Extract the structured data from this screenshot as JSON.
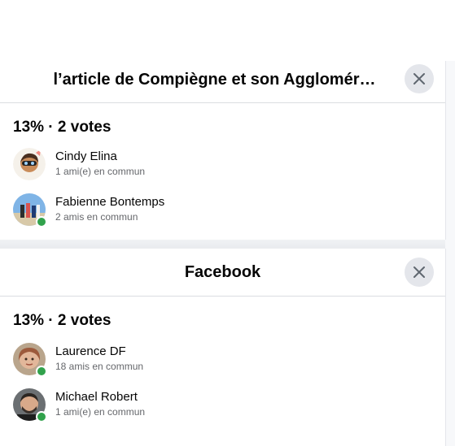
{
  "panels": [
    {
      "title": "l’article de Compiègne et son Agglomér…",
      "votes": "13% · 2 votes",
      "people": [
        {
          "name": "Cindy Elina",
          "mutual": "1 ami(e) en commun",
          "online": false
        },
        {
          "name": "Fabienne Bontemps",
          "mutual": "2 amis en commun",
          "online": true
        }
      ]
    },
    {
      "title": "Facebook",
      "votes": "13% · 2 votes",
      "people": [
        {
          "name": "Laurence DF",
          "mutual": "18 amis en commun",
          "online": true
        },
        {
          "name": "Michael Robert",
          "mutual": "1 ami(e) en commun",
          "online": true
        }
      ]
    }
  ],
  "colors": {
    "online": "#31a24c",
    "close_bg": "#e4e6eb",
    "secondary_text": "#65676b"
  }
}
